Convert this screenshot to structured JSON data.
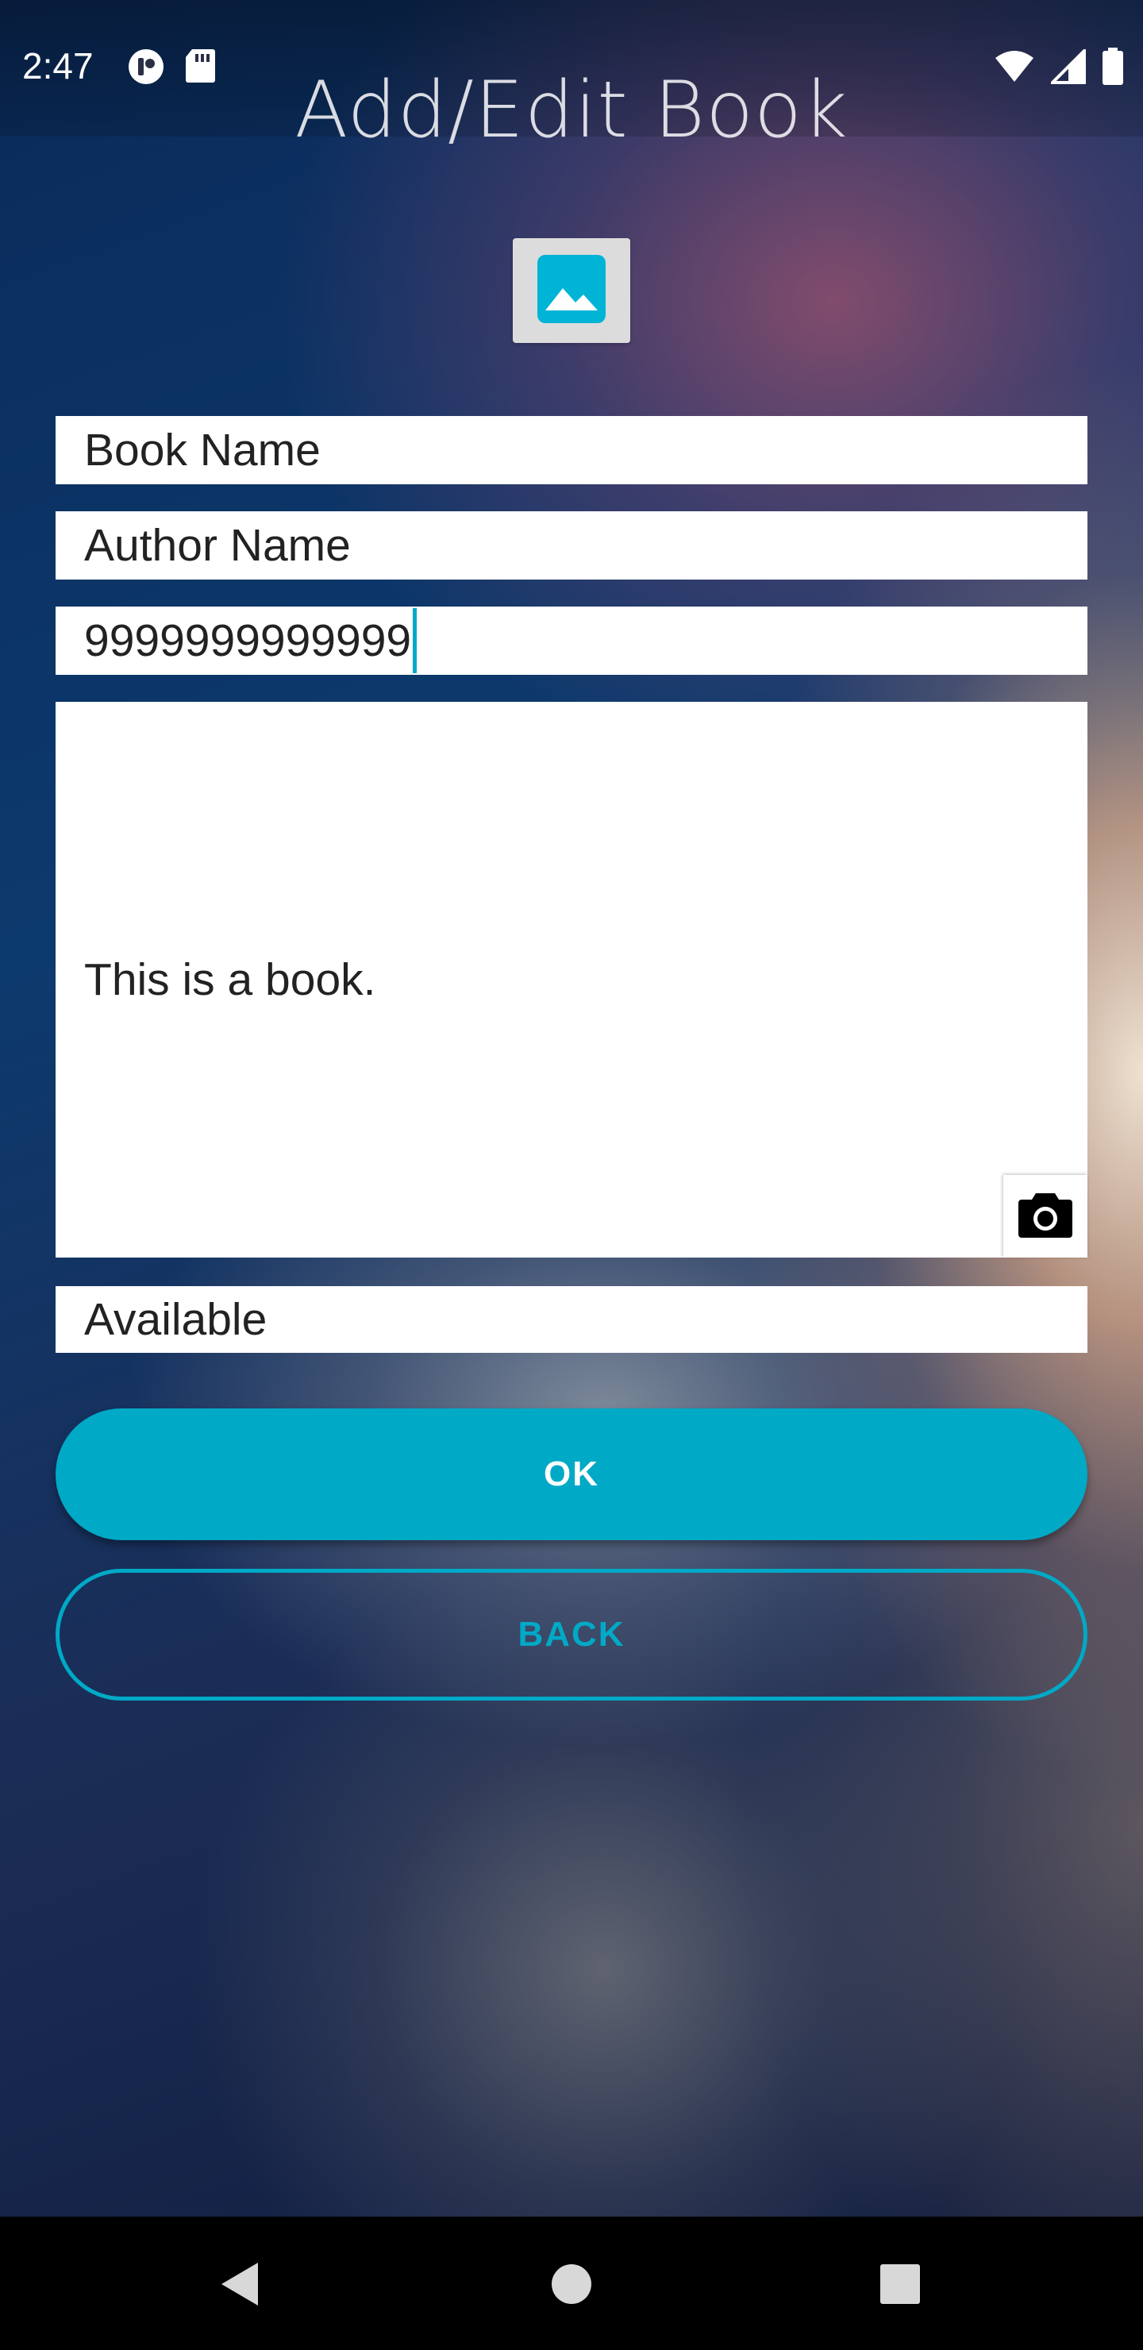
{
  "status_bar": {
    "time": "2:47",
    "left_icons": [
      "app-notification-icon",
      "sd-card-icon"
    ],
    "right_icons": [
      "wifi-icon",
      "signal-icon",
      "battery-icon"
    ]
  },
  "header": {
    "title": "Add/Edit Book"
  },
  "image_picker": {
    "icon": "image-icon",
    "accent_color": "#00B4D6"
  },
  "form": {
    "book_name": "Book Name",
    "author_name": "Author Name",
    "isbn": "9999999999999",
    "description": "This is a book.",
    "availability": "Available",
    "camera_icon": "camera-icon"
  },
  "buttons": {
    "ok_label": "OK",
    "back_label": "BACK",
    "accent_color": "#00A9C6"
  },
  "nav_bar": {
    "icons": [
      "back-triangle-icon",
      "home-circle-icon",
      "recents-square-icon"
    ]
  }
}
